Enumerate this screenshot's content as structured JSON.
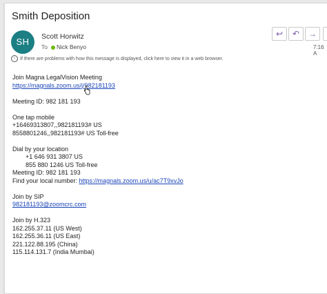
{
  "message": {
    "subject": "Smith Deposition",
    "avatar_initials": "SH",
    "sender": "Scott Horwitz",
    "to_label": "To",
    "recipient": "Nick Benyo",
    "info_text": "If there are problems with how this message is displayed, click here to view it in a web browser.",
    "time": "7:16 A"
  },
  "actions": {
    "reply_icon": "↩",
    "reply_all_icon": "↶",
    "forward_icon": "→",
    "more_icon": "•••"
  },
  "body": {
    "join_heading": "Join Magna LegalVision Meeting",
    "join_link": "https://magnals.zoom.us/j/982181193",
    "meeting_id_1": "Meeting ID: 982 181 193",
    "one_tap_heading": "One tap mobile",
    "one_tap_1": "+16469313807,,982181193# US",
    "one_tap_2": "8558801246,,982181193# US Toll-free",
    "dial_heading": "Dial by your location",
    "dial_1": "+1 646 931 3807 US",
    "dial_2": "855 880 1246 US Toll-free",
    "meeting_id_2": "Meeting ID: 982 181 193",
    "find_local_label": "Find your local number: ",
    "find_local_link": "https://magnals.zoom.us/u/ac7T9xvJo",
    "sip_heading": "Join by SIP",
    "sip_link": "982181193@zoomcrc.com",
    "h323_heading": "Join by H.323",
    "h323_1": "162.255.37.11 (US West)",
    "h323_2": "162.255.36.11 (US East)",
    "h323_3": "221.122.88.195 (China)",
    "h323_4": "115.114.131.7 (India Mumbai)"
  },
  "colors": {
    "avatar_bg": "#1b7f84",
    "link": "#1a44b8",
    "presence": "#6bb700",
    "action_icon": "#7a5ca8"
  }
}
